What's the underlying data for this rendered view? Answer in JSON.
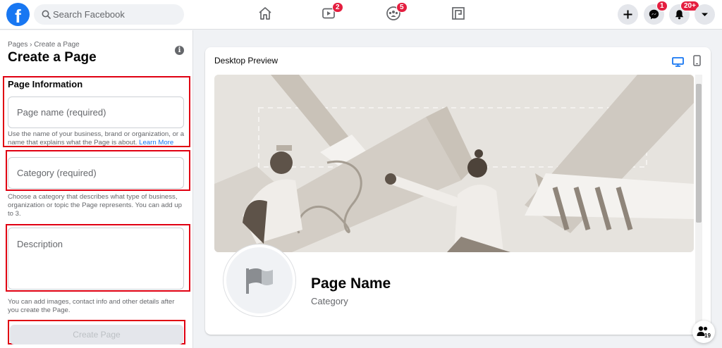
{
  "topbar": {
    "logo": "f",
    "search_placeholder": "Search Facebook",
    "watch_badge": "2",
    "groups_badge": "5",
    "messenger_badge": "1",
    "notifications_badge": "20+"
  },
  "left": {
    "breadcrumb": "Pages › Create a Page",
    "title": "Create a Page",
    "info_glyph": "i",
    "section_title": "Page Information",
    "page_name_placeholder": "Page name (required)",
    "page_name_help": "Use the name of your business, brand or organization, or a name that explains what the Page is about.",
    "learn_more": "Learn More",
    "category_placeholder": "Category (required)",
    "category_help": "Choose a category that describes what type of business, organization or topic the Page represents. You can add up to 3.",
    "description_placeholder": "Description",
    "description_help": "You can add images, contact info and other details after you create the Page.",
    "create_button": "Create Page"
  },
  "preview": {
    "title": "Desktop Preview",
    "page_name": "Page Name",
    "page_category": "Category"
  },
  "contacts": {
    "count": "19"
  },
  "colors": {
    "brand": "#1877f2",
    "highlight": "#e00012",
    "badge": "#e41e3f"
  }
}
